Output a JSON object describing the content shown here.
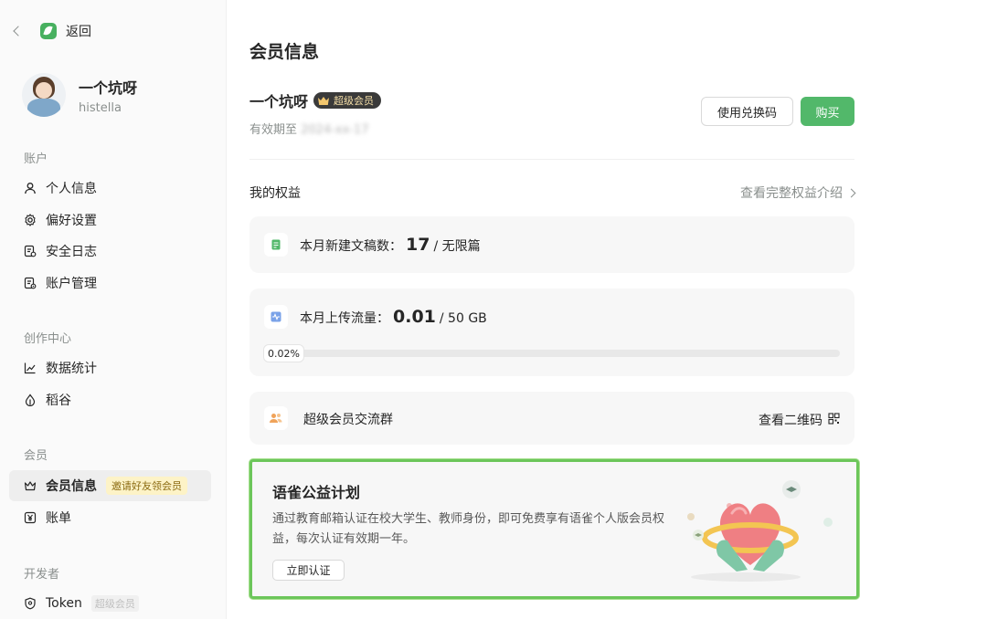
{
  "sidebar": {
    "back_label": "返回",
    "profile": {
      "name": "一个坑呀",
      "username": "histella"
    },
    "sections": [
      {
        "title": "账户",
        "items": [
          {
            "label": "个人信息",
            "icon": "user-icon"
          },
          {
            "label": "偏好设置",
            "icon": "gear-icon"
          },
          {
            "label": "安全日志",
            "icon": "shield-log-icon"
          },
          {
            "label": "账户管理",
            "icon": "account-manage-icon"
          }
        ]
      },
      {
        "title": "创作中心",
        "items": [
          {
            "label": "数据统计",
            "icon": "chart-line-icon"
          },
          {
            "label": "稻谷",
            "icon": "rice-drop-icon"
          }
        ]
      },
      {
        "title": "会员",
        "items": [
          {
            "label": "会员信息",
            "icon": "crown-icon",
            "badge": "邀请好友领会员",
            "active": true
          },
          {
            "label": "账单",
            "icon": "yen-icon"
          }
        ]
      },
      {
        "title": "开发者",
        "items": [
          {
            "label": "Token",
            "icon": "token-shield-icon",
            "badge": "超级会员"
          }
        ]
      }
    ]
  },
  "main": {
    "title": "会员信息",
    "user_name": "一个坑呀",
    "vip_badge": "超级会员",
    "expire_prefix": "有效期至 ",
    "expire_value": "2024-xx-17",
    "redeem_button": "使用兑换码",
    "buy_button": "购买",
    "rights_title": "我的权益",
    "rights_link": "查看完整权益介绍",
    "docs": {
      "label": "本月新建文稿数：",
      "value": "17",
      "limit": " / 无限篇"
    },
    "upload": {
      "label": "本月上传流量：",
      "value": "0.01",
      "limit": " / 50 GB",
      "percent_label": "0.02%",
      "percent": 0.02
    },
    "group": {
      "label": "超级会员交流群",
      "link": "查看二维码"
    },
    "promo": {
      "title": "语雀公益计划",
      "desc": "通过教育邮箱认证在校大学生、教师身份，即可免费享有语雀个人版会员权益，每次认证有效期一年。",
      "button": "立即认证"
    }
  },
  "colors": {
    "accent": "#52b86a",
    "promo_border": "#6cc65a"
  }
}
